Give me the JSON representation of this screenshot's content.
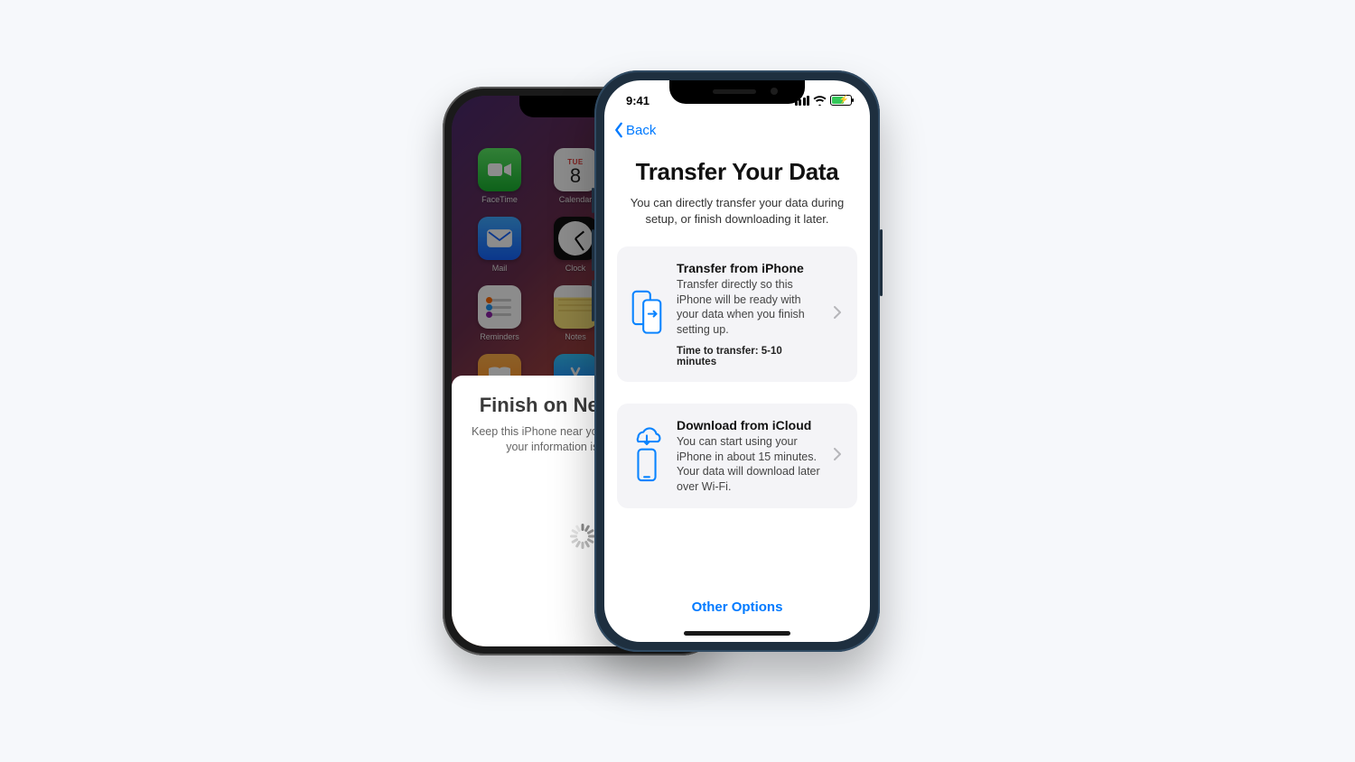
{
  "back_phone": {
    "apps": {
      "facetime": "FaceTime",
      "calendar": {
        "label": "Calendar",
        "dow": "TUE",
        "day": "8"
      },
      "mail": "Mail",
      "clock": "Clock",
      "reminders": "Reminders",
      "notes": "Notes",
      "books": "Books",
      "appstore": "App Store"
    },
    "sheet": {
      "title": "Finish on New iPhone",
      "line1": "Keep this iPhone near your new iPhone until",
      "line2": "your information is transferred."
    }
  },
  "front_phone": {
    "status": {
      "time": "9:41"
    },
    "nav": {
      "back": "Back"
    },
    "page": {
      "title": "Transfer Your Data",
      "sub": "You can directly transfer your data during setup, or finish downloading it later."
    },
    "options": {
      "transfer": {
        "title": "Transfer from iPhone",
        "desc": "Transfer directly so this iPhone will be ready with your data when you finish setting up.",
        "estimate": "Time to transfer: 5-10 minutes"
      },
      "icloud": {
        "title": "Download from iCloud",
        "desc": "You can start using your iPhone in about 15 minutes. Your data will download later over Wi-Fi."
      }
    },
    "footer": {
      "other": "Other Options"
    }
  },
  "colors": {
    "accent": "#007aff",
    "battery": "#34c759"
  }
}
